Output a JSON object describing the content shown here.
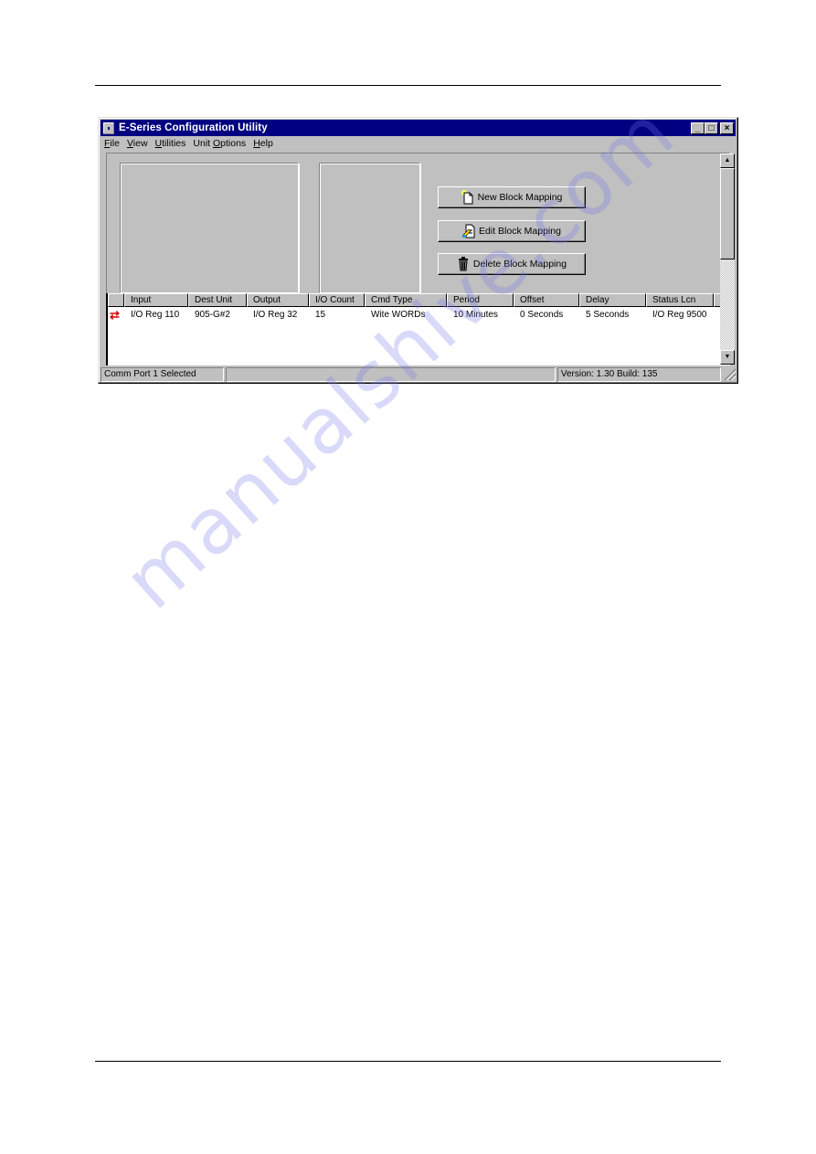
{
  "window": {
    "title": "E-Series Configuration Utility",
    "controls": {
      "minimize": "_",
      "maximize": "□",
      "close": "×"
    }
  },
  "menu": [
    {
      "label": "File",
      "accel": "F",
      "rest": "ile"
    },
    {
      "label": "View",
      "accel": "V",
      "rest": "iew"
    },
    {
      "label": "Utilities",
      "accel": "U",
      "rest": "tilities"
    },
    {
      "label": "Unit Options",
      "pre": "Unit ",
      "accel": "O",
      "rest": "ptions"
    },
    {
      "label": "Help",
      "accel": "H",
      "rest": "elp"
    }
  ],
  "buttons": {
    "new": {
      "label": "New Block Mapping",
      "icon": "new-document-icon"
    },
    "edit": {
      "label": "Edit Block Mapping",
      "icon": "edit-document-icon"
    },
    "delete": {
      "label": "Delete Block Mapping",
      "icon": "trash-icon"
    }
  },
  "grid": {
    "columns": [
      "",
      "Input",
      "Dest Unit",
      "Output",
      "I/O Count",
      "Cmd Type",
      "Period",
      "Offset",
      "Delay",
      "Status Lcn"
    ],
    "rows": [
      {
        "icon": "⇄",
        "cells": [
          "I/O Reg 110",
          "905-G#2",
          "I/O Reg 32",
          "15",
          "Wite WORDs",
          "10 Minutes",
          "0 Seconds",
          "5 Seconds",
          "I/O Reg 9500"
        ]
      }
    ]
  },
  "status": {
    "left": "Comm Port 1 Selected",
    "middle": "",
    "right": "Version: 1.30 Build: 135"
  },
  "scrollbar": {
    "up": "▲",
    "down": "▼"
  },
  "watermark": "manualshive.com",
  "colors": {
    "titlebar": "#000080",
    "face": "#c0c0c0",
    "row_icon": "#d40000"
  }
}
